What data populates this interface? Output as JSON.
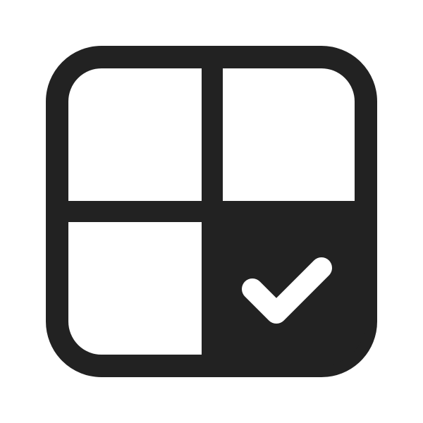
{
  "icon": {
    "name": "grid-checkmark-icon",
    "description_icon_parts": [
      "outer-rounded-square",
      "grid-lines",
      "filled-bottom-right-cell",
      "checkmark"
    ],
    "colors": {
      "stroke": "#222222",
      "fill": "#222222",
      "background": "#ffffff",
      "checkmark": "#ffffff"
    }
  }
}
